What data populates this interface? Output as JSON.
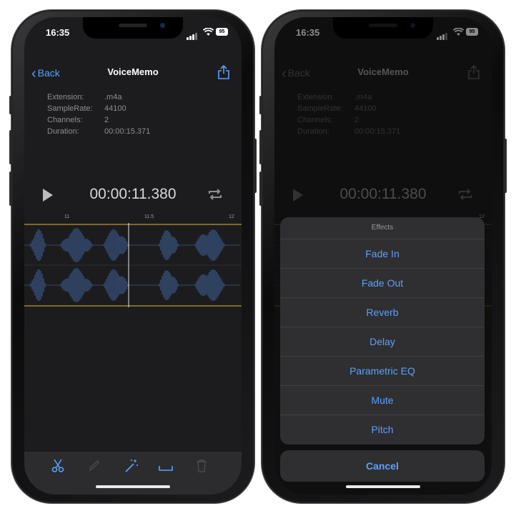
{
  "status": {
    "time": "16:35",
    "battery": "95"
  },
  "nav": {
    "back_label": "Back",
    "title": "VoiceMemo"
  },
  "info": {
    "rows": [
      {
        "label": "Extension:",
        "value": ".m4a"
      },
      {
        "label": "SampleRate:",
        "value": "44100"
      },
      {
        "label": "Channels:",
        "value": "2"
      },
      {
        "label": "Duration:",
        "value": "00:00:15.371"
      }
    ]
  },
  "player": {
    "time": "00:00:11.380"
  },
  "ruler": {
    "ticks": [
      "11",
      "11.5",
      "12"
    ]
  },
  "colors": {
    "accent": "#5aa0ff",
    "waveform": "#3a5a8a",
    "selection": "#e0b53a",
    "background": "#1c1c1e"
  },
  "toolbar": {
    "icons": [
      "scissors-icon",
      "pencil-icon",
      "magic-wand-icon",
      "space-icon",
      "trash-icon"
    ]
  },
  "effects": {
    "title": "Effects",
    "items": [
      "Fade In",
      "Fade Out",
      "Reverb",
      "Delay",
      "Parametric EQ",
      "Mute",
      "Pitch"
    ],
    "cancel": "Cancel"
  }
}
